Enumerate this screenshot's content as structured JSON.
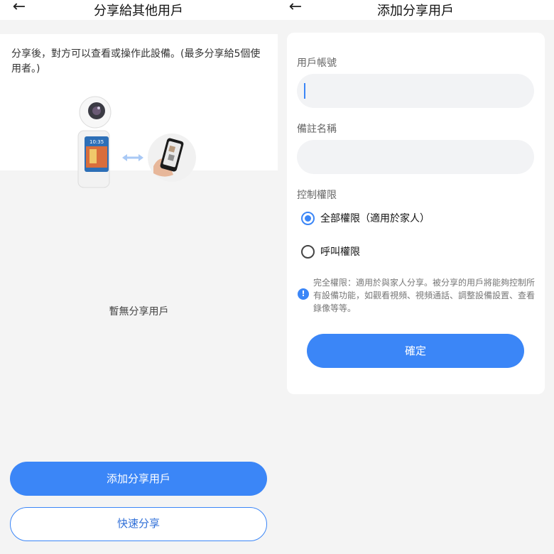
{
  "left": {
    "title": "分享給其他用戶",
    "back_icon": "arrow-left-icon",
    "intro": "分享後，對方可以查看或操作此設備。(最多分享給5個使用者。)",
    "device_time": "10:35",
    "empty_text": "暫無分享用戶",
    "add_button": "添加分享用戶",
    "quick_share_button": "快速分享"
  },
  "right": {
    "title": "添加分享用戶",
    "back_icon": "arrow-left-icon",
    "account_label": "用戶帳號",
    "account_value": "",
    "note_label": "備註名稱",
    "note_value": "",
    "permission_label": "控制權限",
    "options": [
      {
        "label": "全部權限（適用於家人）",
        "checked": true
      },
      {
        "label": "呼叫權限",
        "checked": false
      }
    ],
    "info_text": "完全權限：適用於與家人分享。被分享的用戶將能夠控制所有設備功能，如觀看視頻、視頻通話、調整設備設置、查看錄像等等。",
    "confirm_button": "確定"
  },
  "colors": {
    "accent": "#3b86f7",
    "background": "#f4f4f4",
    "card": "#ffffff"
  }
}
